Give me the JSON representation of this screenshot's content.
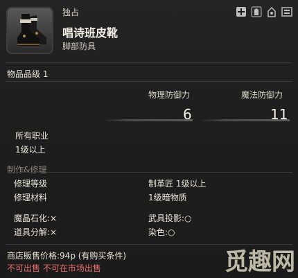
{
  "header": {
    "unique_label": "独占",
    "item_name": "唱诗班皮靴",
    "category": "脚部防具",
    "icons": [
      "plus-cross-icon",
      "glamour-icon",
      "dye-icon",
      "market-icon"
    ]
  },
  "item_level": "物品品级 1",
  "stats": {
    "physical_label": "物理防御力",
    "physical_value": "6",
    "magic_label": "魔法防御力",
    "magic_value": "11"
  },
  "jobs": {
    "classes": "所有职业",
    "level": "1级以上"
  },
  "crafting": {
    "section_title": "制作&修理",
    "repair_level_label": "修理等级",
    "repair_level_value": "制革匠 1级以上",
    "repair_material_label": "修理材料",
    "repair_material_value": "1级暗物质",
    "materia_label": "魔晶石化:×",
    "projection_label": "武具投影:○",
    "desynth_label": "道具分解:×",
    "dye_label": "染色:○"
  },
  "footer": {
    "price": "商店販售价格:94p (有购买条件)",
    "untradable": "不可出售 不可在市场出售"
  },
  "watermark": "觅趣网",
  "colors": {
    "background": "#1b1b1b",
    "text": "#e8e4d8",
    "muted": "#8a8678",
    "warning": "#e66b6b"
  }
}
